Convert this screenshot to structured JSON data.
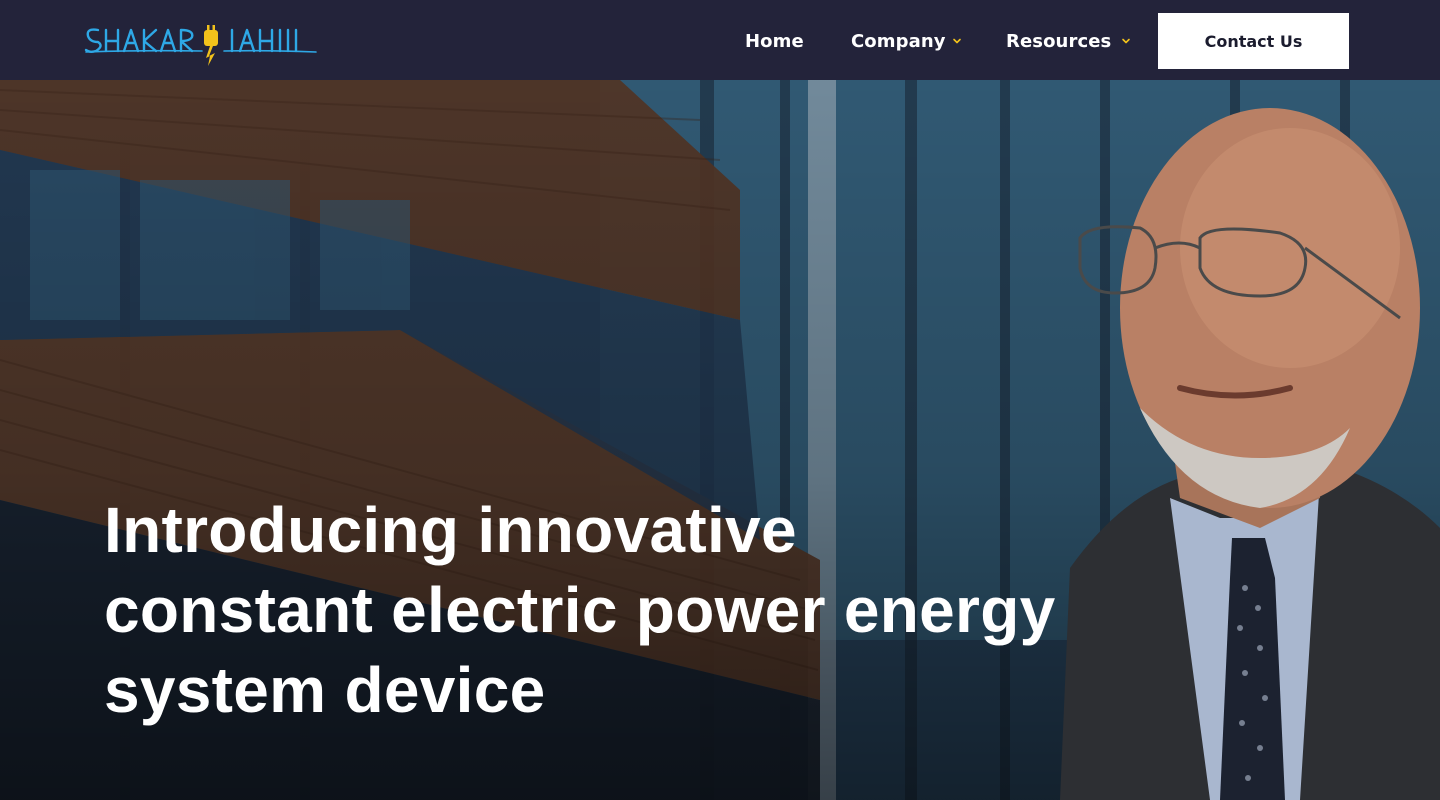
{
  "brand": {
    "logo_text": "SHAKARIAHI",
    "logo_color": "#2ea8e6",
    "bolt_color": "#f2c21b"
  },
  "nav": {
    "home": "Home",
    "company": "Company",
    "resources": "Resources",
    "chevron_icon": "chevron-down-icon",
    "chevron_color": "#f2c21b"
  },
  "cta": {
    "contact": "Contact Us"
  },
  "hero": {
    "headline": [
      "Introducing innovative",
      "constant electric power energy",
      "system device"
    ]
  },
  "colors": {
    "header_bg": "#23233a",
    "button_bg": "#ffffff",
    "button_text": "#1b1c2e"
  }
}
